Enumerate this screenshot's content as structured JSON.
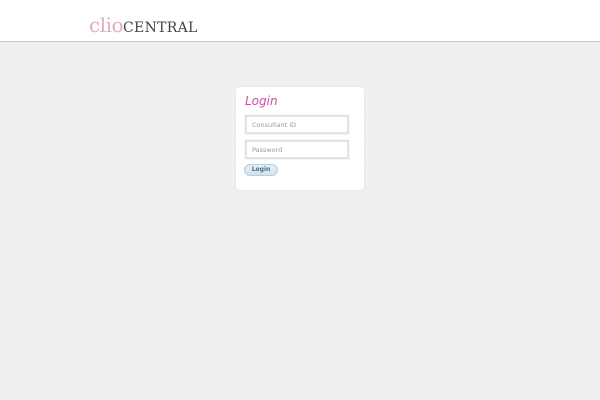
{
  "header": {
    "logo": {
      "part1": "clio",
      "part2": "CENTRAL"
    }
  },
  "login": {
    "title": "Login",
    "consultant_id": {
      "placeholder": "Consultant ID",
      "value": ""
    },
    "password": {
      "placeholder": "Password",
      "value": ""
    },
    "button_label": "Login"
  },
  "colors": {
    "brand_pink": "#c7519b",
    "logo_pink": "#e6aac6",
    "page_background": "#f0f0ef",
    "button_blue": "#cfe2ec"
  }
}
